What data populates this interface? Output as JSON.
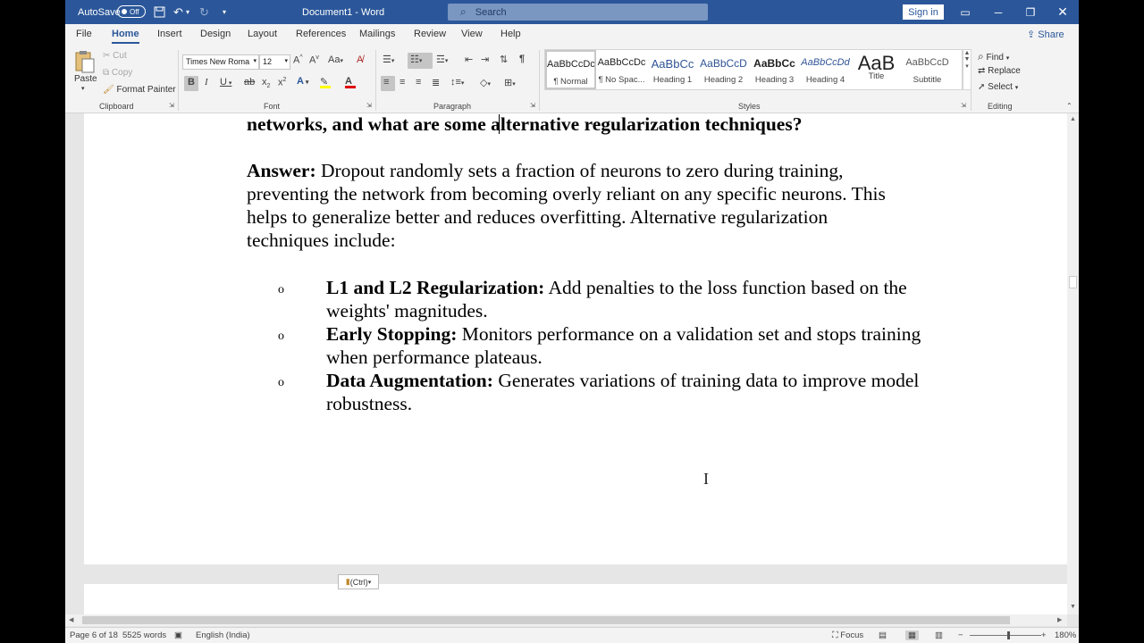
{
  "titlebar": {
    "autosave_label": "AutoSave",
    "autosave_state": "Off",
    "document_title": "Document1 - Word",
    "search_placeholder": "Search",
    "signin_label": "Sign in",
    "accent_color": "#2b579a"
  },
  "tabs": [
    "File",
    "Home",
    "Insert",
    "Design",
    "Layout",
    "References",
    "Mailings",
    "Review",
    "View",
    "Help"
  ],
  "active_tab": "Home",
  "share_label": "Share",
  "ribbon": {
    "clipboard": {
      "paste": "Paste",
      "cut": "Cut",
      "copy": "Copy",
      "format_painter": "Format Painter",
      "group_label": "Clipboard"
    },
    "font": {
      "font_name": "Times New Roma",
      "font_size": "12",
      "group_label": "Font"
    },
    "paragraph": {
      "group_label": "Paragraph"
    },
    "styles": {
      "group_label": "Styles",
      "items": [
        {
          "sample": "AaBbCcDc",
          "name": "¶ Normal"
        },
        {
          "sample": "AaBbCcDc",
          "name": "¶ No Spac..."
        },
        {
          "sample": "AaBbCc",
          "name": "Heading 1"
        },
        {
          "sample": "AaBbCcD",
          "name": "Heading 2"
        },
        {
          "sample": "AaBbCc",
          "name": "Heading 3"
        },
        {
          "sample": "AaBbCcDd",
          "name": "Heading 4"
        },
        {
          "sample": "AaB",
          "name": "Title"
        },
        {
          "sample": "AaBbCcD",
          "name": "Subtitle"
        }
      ]
    },
    "editing": {
      "find": "Find",
      "replace": "Replace",
      "select": "Select",
      "group_label": "Editing"
    }
  },
  "document": {
    "question_line": "networks, and what are some alternative regularization techniques?",
    "answer_label": "Answer:",
    "answer_lines": [
      " Dropout randomly sets a fraction of neurons to zero during training,",
      "preventing the network from becoming overly reliant on any specific neurons. This",
      "helps to generalize better and reduces overfitting. Alternative regularization",
      "techniques include:"
    ],
    "bullets": [
      {
        "term": "L1 and L2 Regularization:",
        "line1": " Add penalties to the loss function based on the",
        "line2": "weights' magnitudes."
      },
      {
        "term": "Early Stopping:",
        "line1": " Monitors performance on a validation set and stops training",
        "line2": "when performance plateaus."
      },
      {
        "term": "Data Augmentation:",
        "line1": " Generates variations of training data to improve model",
        "line2": "robustness."
      }
    ],
    "paste_options": "(Ctrl)"
  },
  "status": {
    "page": "Page 6 of 18",
    "words": "5525 words",
    "language": "English (India)",
    "focus": "Focus",
    "zoom": "180%"
  }
}
